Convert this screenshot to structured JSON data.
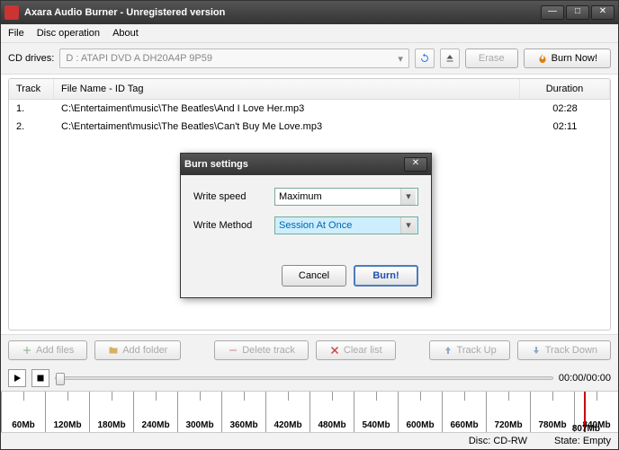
{
  "window": {
    "title": "Axara Audio Burner - Unregistered version"
  },
  "menu": {
    "file": "File",
    "disc": "Disc operation",
    "about": "About"
  },
  "toolbar": {
    "cddrives_label": "CD drives:",
    "drive_value": "D : ATAPI   DVD A  DH20A4P   9P59",
    "erase": "Erase",
    "burn_now": "Burn Now!"
  },
  "list": {
    "head_track": "Track",
    "head_file": "File Name - ID Tag",
    "head_duration": "Duration",
    "rows": [
      {
        "n": "1.",
        "file": "C:\\Entertaiment\\music\\The Beatles\\And I Love Her.mp3",
        "dur": "02:28"
      },
      {
        "n": "2.",
        "file": "C:\\Entertaiment\\music\\The Beatles\\Can't Buy Me Love.mp3",
        "dur": "02:11"
      }
    ]
  },
  "btns": {
    "add_files": "Add files",
    "add_folder": "Add folder",
    "delete_track": "Delete track",
    "clear_list": "Clear list",
    "track_up": "Track Up",
    "track_down": "Track Down"
  },
  "play": {
    "time": "00:00/00:00"
  },
  "scale": {
    "ticks": [
      "60Mb",
      "120Mb",
      "180Mb",
      "240Mb",
      "300Mb",
      "360Mb",
      "420Mb",
      "480Mb",
      "540Mb",
      "600Mb",
      "660Mb",
      "720Mb",
      "780Mb",
      "840Mb"
    ],
    "capacity": "807Mb"
  },
  "status": {
    "disc": "Disc: CD-RW",
    "state": "State: Empty"
  },
  "dialog": {
    "title": "Burn settings",
    "write_speed_label": "Write speed",
    "write_speed_value": "Maximum",
    "write_method_label": "Write Method",
    "write_method_value": "Session At Once",
    "cancel": "Cancel",
    "burn": "Burn!"
  }
}
